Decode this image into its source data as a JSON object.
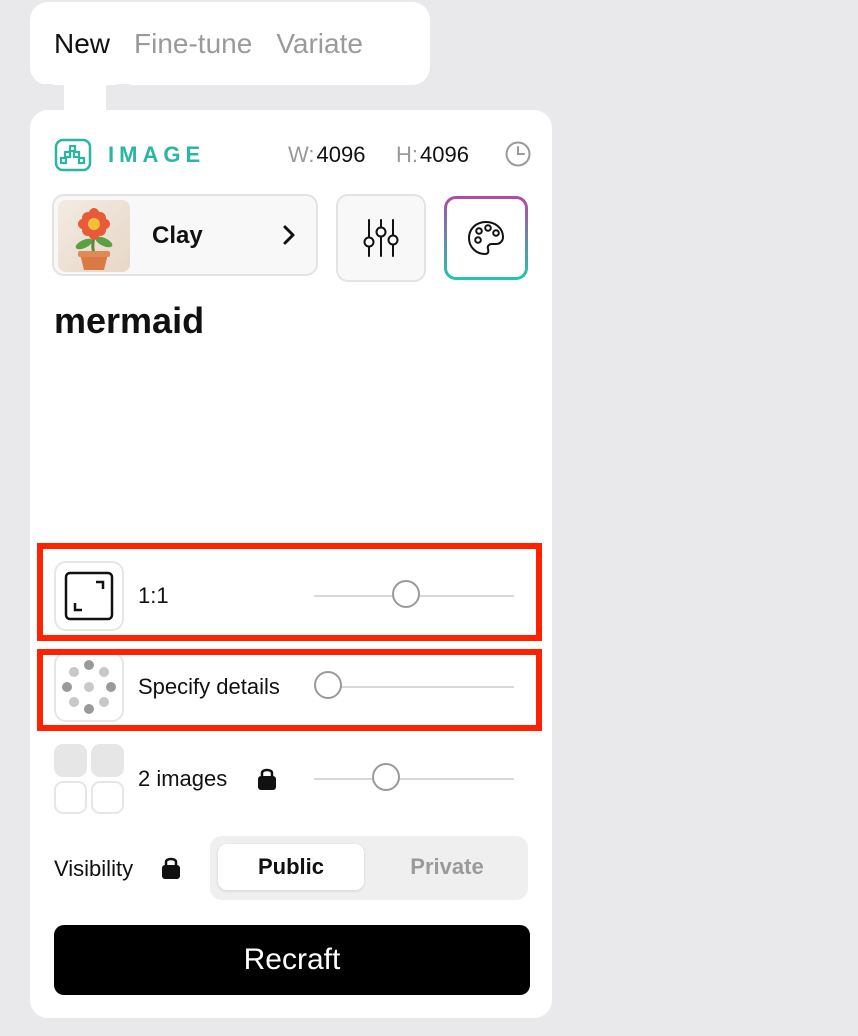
{
  "tabs": [
    {
      "label": "New",
      "active": true
    },
    {
      "label": "Fine-tune",
      "active": false
    },
    {
      "label": "Variate",
      "active": false
    }
  ],
  "header": {
    "mode_label": "IMAGE",
    "width_key": "W:",
    "width_value": "4096",
    "height_key": "H:",
    "height_value": "4096",
    "icons": {
      "mode": "image-grid-icon",
      "history": "clock-icon"
    }
  },
  "style": {
    "name": "Clay",
    "thumbnail": "clay-flower-pot-thumbnail",
    "icons": {
      "open": "chevron-right-icon",
      "settings": "sliders-icon",
      "palette": "palette-icon"
    }
  },
  "prompt": {
    "text": "mermaid"
  },
  "controls": {
    "aspect_ratio": {
      "label": "1:1",
      "level": 0.46,
      "icon": "aspect-ratio-icon"
    },
    "details": {
      "label": "Specify details",
      "level": 0.07,
      "icon": "dots-circle-icon"
    },
    "count": {
      "label": "2 images",
      "level": 0.36,
      "locked": true,
      "icon": "image-grid-icon"
    }
  },
  "visibility": {
    "label": "Visibility",
    "locked": true,
    "options": [
      {
        "label": "Public",
        "selected": true
      },
      {
        "label": "Private",
        "selected": false
      }
    ]
  },
  "action": {
    "label": "Recraft"
  },
  "colors": {
    "accent_teal": "#2ab6a3",
    "palette_gradient_top": "#b04aa6",
    "highlight": "#ff2200",
    "button": "#000000"
  }
}
